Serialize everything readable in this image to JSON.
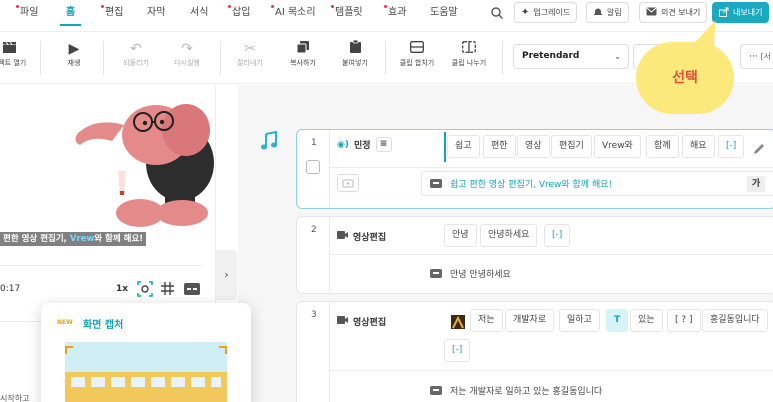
{
  "menu": [
    {
      "label": "파일",
      "dot": true
    },
    {
      "label": "홈",
      "dot": false,
      "active": true
    },
    {
      "label": "편집",
      "dot": true
    },
    {
      "label": "자막",
      "dot": false
    },
    {
      "label": "서식",
      "dot": false
    },
    {
      "label": "삽입",
      "dot": true
    },
    {
      "label": "AI 목소리",
      "dot": true
    },
    {
      "label": "템플릿",
      "dot": true
    },
    {
      "label": "효과",
      "dot": true
    },
    {
      "label": "도움말",
      "dot": false
    }
  ],
  "topbar": {
    "search_icon": "search-icon",
    "upgrade": "업그레이드",
    "notifications": "알림",
    "feedback": "의견 보내기",
    "export": "내보내기"
  },
  "toolbar": {
    "open_project": "로젝트 열기",
    "play": "재생",
    "undo": "되돌리기",
    "redo": "다시실행",
    "cut": "잘라내기",
    "copy": "복사하기",
    "paste": "붙여넣기",
    "merge_clip": "클립 합치기",
    "split_clip": "클립 나누기",
    "font": "Pretendard",
    "more": "···",
    "more_suffix": "[서"
  },
  "preview": {
    "caption_pre": "편한 영상 편집기, ",
    "caption_brand": "Vrew",
    "caption_post": "와 함께 해요!",
    "time": "0:17",
    "speed": "1x"
  },
  "capture_popup": {
    "badge": "NEW",
    "title": "화면 캡처"
  },
  "left_bottom_text": "시작하고",
  "annotation": "선택",
  "clips": [
    {
      "num": "1",
      "speaker": "민정",
      "words": [
        "쉽고",
        "편한",
        "영상",
        "편집기",
        "Vrew와",
        "함께",
        "해요",
        "[-]"
      ],
      "subtitle": "쉽고 편한 영상 편집기, Vrew와 함께 해요!",
      "style_badge": "가"
    },
    {
      "num": "2",
      "speaker": "영상편집",
      "words": [
        "안녕",
        "안녕하세요",
        "[-]"
      ],
      "subtitle": "안녕 안녕하세요"
    },
    {
      "num": "3",
      "speaker": "영상편집",
      "words": [
        "저는",
        "개발자로",
        "일하고",
        "T",
        "있는",
        "[ ? ]",
        "홍길동입니다",
        "[-]"
      ],
      "subtitle": "저는 개발자로 일하고 있는 홍길동입니다"
    }
  ],
  "colors": {
    "accent": "#13a4b6",
    "export_bg": "#1ba8c1",
    "annotation_bg": "#fbe97c",
    "annotation_text": "#e0503a",
    "elephant": "#e58a8a"
  }
}
